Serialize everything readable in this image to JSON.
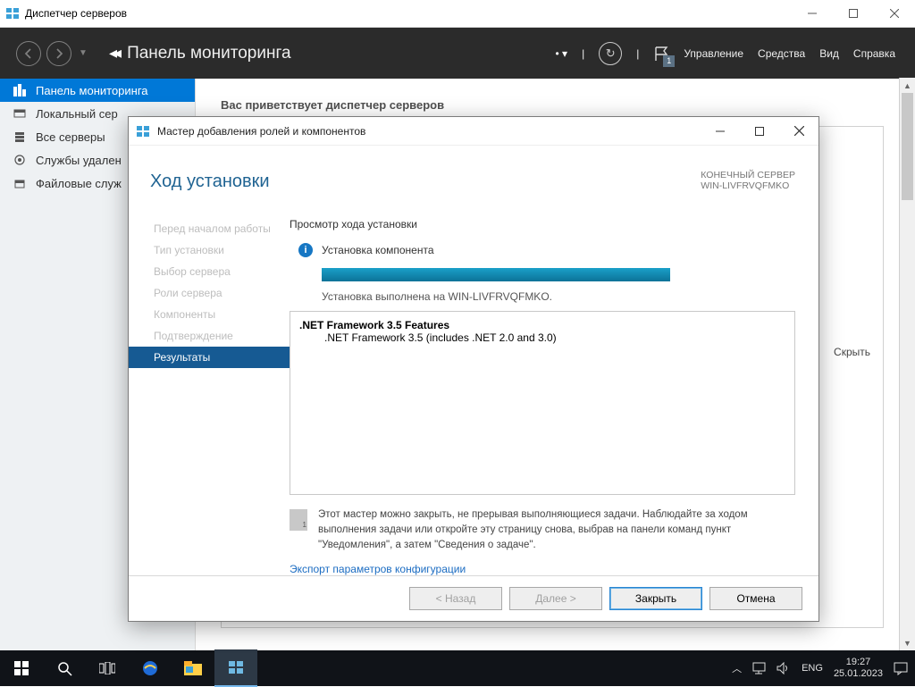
{
  "window": {
    "title": "Диспетчер серверов"
  },
  "header": {
    "title": "Панель мониторинга",
    "menu": {
      "manage": "Управление",
      "tools": "Средства",
      "view": "Вид",
      "help": "Справка"
    },
    "flag_badge": "1"
  },
  "sidebar": {
    "items": [
      {
        "label": "Панель мониторинга"
      },
      {
        "label": "Локальный сер"
      },
      {
        "label": "Все серверы"
      },
      {
        "label": "Службы удален"
      },
      {
        "label": "Файловые служ"
      }
    ]
  },
  "main": {
    "welcome": "Вас приветствует диспетчер серверов",
    "hide_label": "Скрыть"
  },
  "wizard": {
    "title": "Мастер добавления ролей и компонентов",
    "heading": "Ход установки",
    "dest_line1": "КОНЕЧНЫЙ СЕРВЕР",
    "dest_line2": "WIN-LIVFRVQFMKO",
    "nav": [
      "Перед началом работы",
      "Тип установки",
      "Выбор сервера",
      "Роли сервера",
      "Компоненты",
      "Подтверждение",
      "Результаты"
    ],
    "subtitle": "Просмотр хода установки",
    "status_label": "Установка компонента",
    "status_done": "Установка выполнена на WIN-LIVFRVQFMKO.",
    "results": {
      "parent": ".NET Framework 3.5 Features",
      "child": ".NET Framework 3.5 (includes .NET 2.0 and 3.0)"
    },
    "note": "Этот мастер можно закрыть, не прерывая выполняющиеся задачи. Наблюдайте за ходом выполнения задачи или откройте эту страницу снова, выбрав на панели команд пункт \"Уведомления\", а затем \"Сведения о задаче\".",
    "export_link": "Экспорт параметров конфигурации",
    "buttons": {
      "back": "< Назад",
      "next": "Далее >",
      "close": "Закрыть",
      "cancel": "Отмена"
    }
  },
  "taskbar": {
    "lang": "ENG",
    "time": "19:27",
    "date": "25.01.2023"
  }
}
